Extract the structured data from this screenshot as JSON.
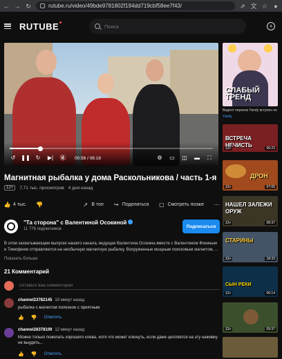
{
  "browser": {
    "url": "rutube.ru/video/49bde9781802f194dd719cbf58ee7f43/"
  },
  "header": {
    "logo": "RUTUBE",
    "search_placeholder": "Поиск"
  },
  "player": {
    "time": "00:56 / 06:18",
    "progress_fraction": 0.148
  },
  "video": {
    "title": "Магнитная рыбалка у дома Раскольникова / часть 1-я",
    "age": "12+",
    "views": "7,71 тыс. просмотров",
    "posted": "4 дня назад",
    "likes": "4 тыс.",
    "actions": {
      "top": "В топ",
      "share": "Поделиться",
      "later": "Смотреть позже"
    }
  },
  "channel": {
    "name": "\"Та сторона\" с Валентиной Осокиной",
    "subscribers": "11 776 подписчиков",
    "subscribe": "Подписаться"
  },
  "description": {
    "text": "В этом захватывающем выпуске нашего канала, ведущая Валентина Осокина вместе с Валентином Фокиным и Тимофеем отправляются на необычную магнитную рыбалку. Вооруженные мощным поисковым магнитом, ...",
    "more": "Показать больше"
  },
  "comments": {
    "heading": "21 Комментарий",
    "placeholder": "Оставьте ваш комментарий",
    "items": [
      {
        "author": "channel23782145",
        "time": "10 минут назад",
        "text": "рыбалка с магнитом полезное с приятным",
        "reply": "Ответить",
        "avatar_color": "#8a3b3b"
      },
      {
        "author": "channel28378109",
        "time": "12 минут назад",
        "text": "Можно только пожелать хорошего клева, хотя что может клюнуть, если даже цепляется на эту наживку не выудить...",
        "reply": "Ответить",
        "avatar_color": "#6a3e98"
      }
    ]
  },
  "sidebar": {
    "ad": {
      "headline": "СЛАБЫЙ ТРЕНД",
      "caption": "Видеот перехов Yandy встроен по",
      "brand": "Yandy"
    },
    "cards": [
      {
        "word": "ВСТРЕЧА НЕЧИСТЬ",
        "duration": "06:23",
        "age": "12+",
        "bg": "#7a1f22"
      },
      {
        "word": "ДРОН",
        "duration": "07:05",
        "age": "12+",
        "bg": "#a04a1d"
      },
      {
        "word": "НАШЕЛ ЗАЛЕЖИ ОРУЖ",
        "duration": "08:37",
        "age": "12+",
        "bg": "#3b3526"
      },
      {
        "word": "СТАРИНЫ",
        "duration": "18:33",
        "age": "12+",
        "bg": "#445466"
      },
      {
        "word": "СЫН РЕКИ",
        "duration": "06:14",
        "age": "12+",
        "bg": "#0e2f48"
      },
      {
        "word": "",
        "duration": "09:37",
        "age": "12+",
        "bg": "#3c4f2c"
      },
      {
        "word": "",
        "duration": "",
        "age": "",
        "bg": "#6b5b3a"
      }
    ]
  }
}
